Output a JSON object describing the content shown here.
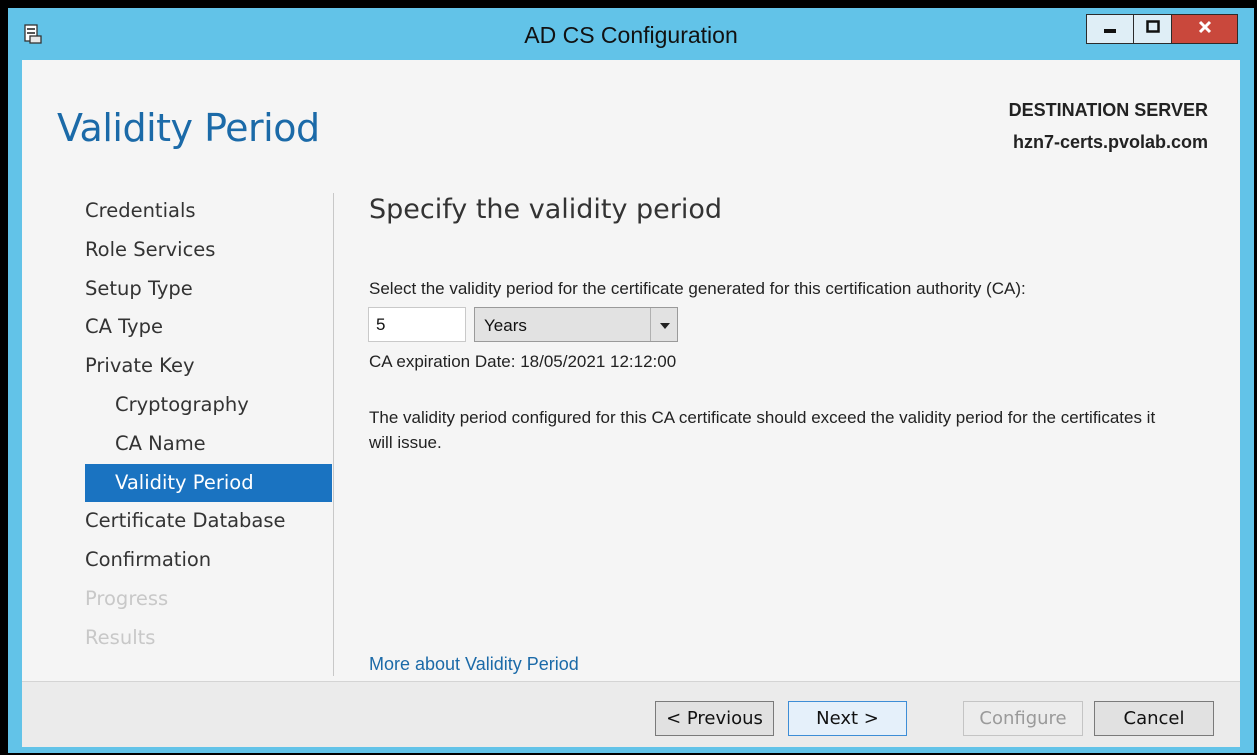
{
  "window": {
    "title": "AD CS Configuration",
    "icon": "server-config-icon",
    "controls": {
      "minimize": "minimize-icon",
      "maximize": "maximize-icon",
      "close": "close-icon"
    }
  },
  "header": {
    "page_title": "Validity Period",
    "destination_label": "DESTINATION SERVER",
    "destination_host": "hzn7-certs.pvolab.com"
  },
  "nav": {
    "items": [
      {
        "label": "Credentials"
      },
      {
        "label": "Role Services"
      },
      {
        "label": "Setup Type"
      },
      {
        "label": "CA Type"
      },
      {
        "label": "Private Key"
      },
      {
        "label": "Cryptography"
      },
      {
        "label": "CA Name"
      },
      {
        "label": "Validity Period"
      },
      {
        "label": "Certificate Database"
      },
      {
        "label": "Confirmation"
      },
      {
        "label": "Progress"
      },
      {
        "label": "Results"
      }
    ]
  },
  "main": {
    "section_title": "Specify the validity period",
    "instruction": "Select the validity period for the certificate generated for this certification authority (CA):",
    "period_value": "5",
    "period_unit": "Years",
    "expiration": "CA expiration Date: 18/05/2021 12:12:00",
    "note": "The validity period configured for this CA certificate should exceed the validity period for the certificates it will issue.",
    "more_link": "More about Validity Period"
  },
  "footer": {
    "previous": "< Previous",
    "next": "Next >",
    "configure": "Configure",
    "cancel": "Cancel"
  },
  "colors": {
    "title_bar": "#62c3e8",
    "accent": "#1a73c1",
    "link": "#1b6aa8",
    "close_button": "#c9483c"
  }
}
